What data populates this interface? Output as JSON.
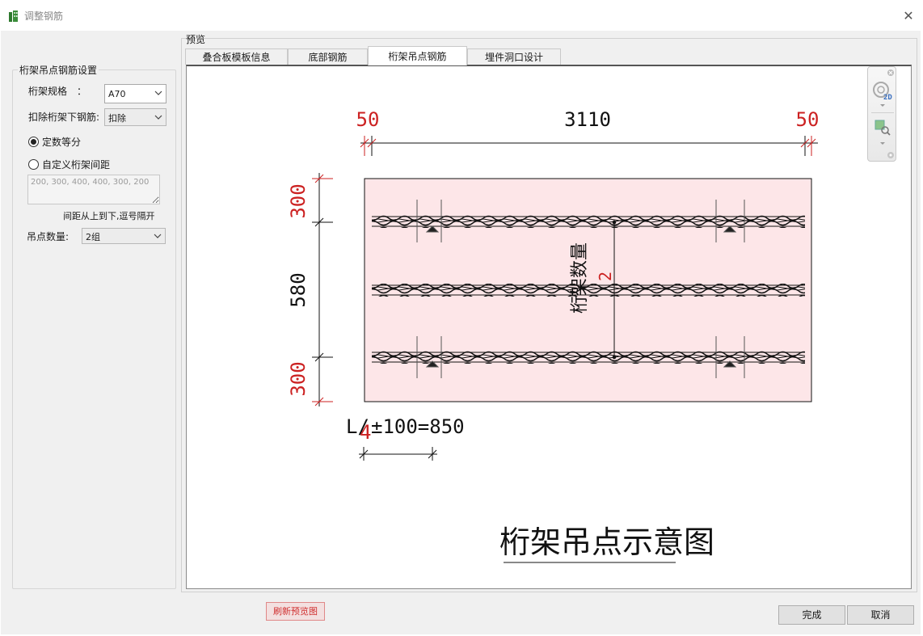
{
  "window": {
    "title": "调整钢筋",
    "close_glyph": "✕",
    "icon": "app-building-icon"
  },
  "settings": {
    "group_title": "桁架吊点钢筋设置",
    "truss_spec_label": "桁架规格　：",
    "truss_spec_value": "A70",
    "deduct_label": "扣除桁架下钢筋:",
    "deduct_value": "扣除",
    "radio_equal_label": "定数等分",
    "radio_equal_selected": true,
    "radio_custom_label": "自定义桁架间距",
    "radio_custom_selected": false,
    "custom_spacing_value": "200, 300, 400, 400, 300, 200",
    "spacing_hint": "间距从上到下,逗号隔开",
    "lift_count_label": "吊点数量:",
    "lift_count_value": "2组"
  },
  "preview": {
    "group_title": "预览",
    "tabs": [
      {
        "label": "叠合板模板信息",
        "active": false
      },
      {
        "label": "底部钢筋",
        "active": false
      },
      {
        "label": "桁架吊点钢筋",
        "active": true
      },
      {
        "label": "埋件洞口设计",
        "active": false
      }
    ],
    "toolbar": {
      "view_2d_icon": "view-2d-icon",
      "view_2d_label": "2D",
      "zoom_icon": "zoom-region-icon",
      "close_icon": "close-icon"
    }
  },
  "drawing": {
    "dim_left_margin": "50",
    "dim_total_width": "3110",
    "dim_right_margin": "50",
    "dim_top_edge": "300",
    "dim_truss_gap": "580",
    "dim_bottom_edge": "300",
    "truss_count_label": "桁架数量",
    "truss_count_value": "2",
    "lift_formula_prefix": "L/",
    "lift_formula_divisor": "4",
    "lift_formula_suffix": "±100=850",
    "caption": "桁架吊点示意图",
    "colors": {
      "slab_fill": "#fde6e8",
      "dim_red": "#cc2222",
      "line_black": "#111111"
    }
  },
  "buttons": {
    "refresh": "刷新预览图",
    "ok": "完成",
    "cancel": "取消"
  }
}
